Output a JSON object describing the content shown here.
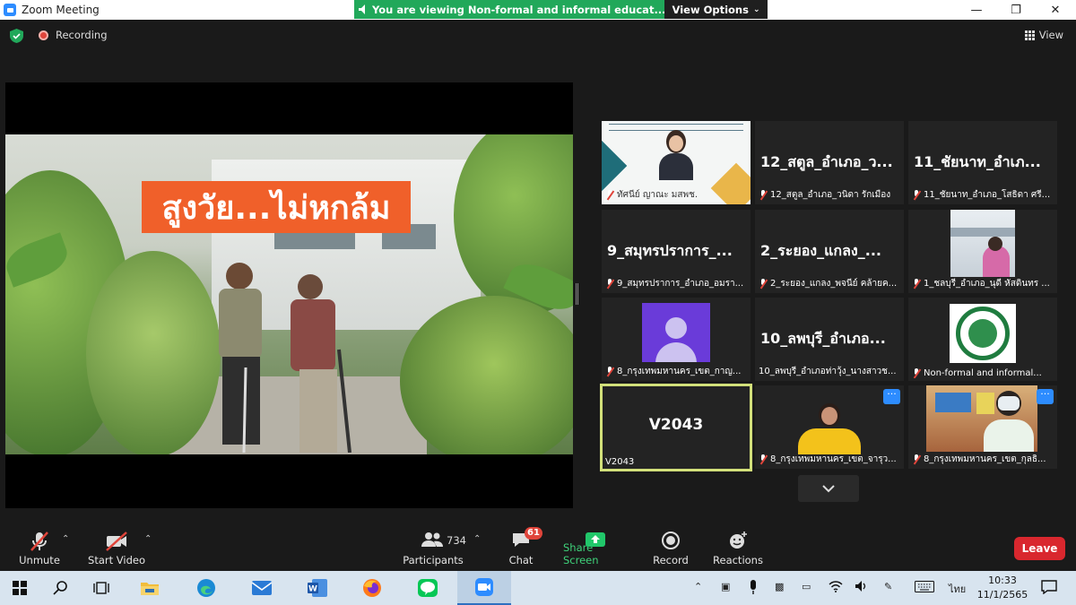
{
  "window": {
    "title": "Zoom Meeting"
  },
  "share_banner": {
    "text": "You are viewing Non-formal and informal educat...'s screen",
    "view_options": "View Options"
  },
  "status": {
    "recording": "Recording",
    "view": "View"
  },
  "shared_screen": {
    "video_title": "สูงวัย...ไม่หกล้ม"
  },
  "gallery": {
    "tiles": [
      {
        "big": "",
        "label": "ทัศนีย์ ญาณะ มสพช."
      },
      {
        "big": "12_สตูล_อำเภอ_ว...",
        "label": "12_สตูล_อำเภอ_วนิดา รักเมือง"
      },
      {
        "big": "11_ชัยนาท_อำเภ...",
        "label": "11_ชัยนาท_อำเภอ_โสธิดา ศรี..."
      },
      {
        "big": "9_สมุทรปราการ_...",
        "label": "9_สมุทรปราการ_อำเภอ_อมรา..."
      },
      {
        "big": "2_ระยอง_แกลง_...",
        "label": "2_ระยอง_แกลง_พจนีย์ คล้ายค..."
      },
      {
        "big": "",
        "label": "1_ชลบุรี_อำเภอ_นุดี หัสดินทร ..."
      },
      {
        "big": "",
        "label": "8_กรุงเทพมหานคร_เขต_กาญ..."
      },
      {
        "big": "10_ลพบุรี_อำเภอ...",
        "label": "10_ลพบุรี_อำเภอท่าวุ้ง_นางสาวช..."
      },
      {
        "big": "",
        "label": "Non-formal and informal..."
      },
      {
        "big": "V2043",
        "label": "V2043"
      },
      {
        "big": "",
        "label": "8_กรุงเทพมหานคร_เขต_จารุว..."
      },
      {
        "big": "",
        "label": "8_กรุงเทพมหานคร_เขต_กุลธิ..."
      }
    ],
    "more_button": "···"
  },
  "toolbar": {
    "unmute": "Unmute",
    "start_video": "Start Video",
    "participants": "Participants",
    "participants_count": "734",
    "chat": "Chat",
    "chat_badge": "61",
    "share_screen": "Share Screen",
    "record": "Record",
    "reactions": "Reactions",
    "leave": "Leave"
  },
  "taskbar": {
    "language": "ไทย",
    "time": "10:33",
    "date": "11/1/2565"
  },
  "colors": {
    "accent": "#2d8cff",
    "share_green": "#21a85a",
    "leave_red": "#d9272e",
    "active_speaker": "#d2e07a"
  }
}
